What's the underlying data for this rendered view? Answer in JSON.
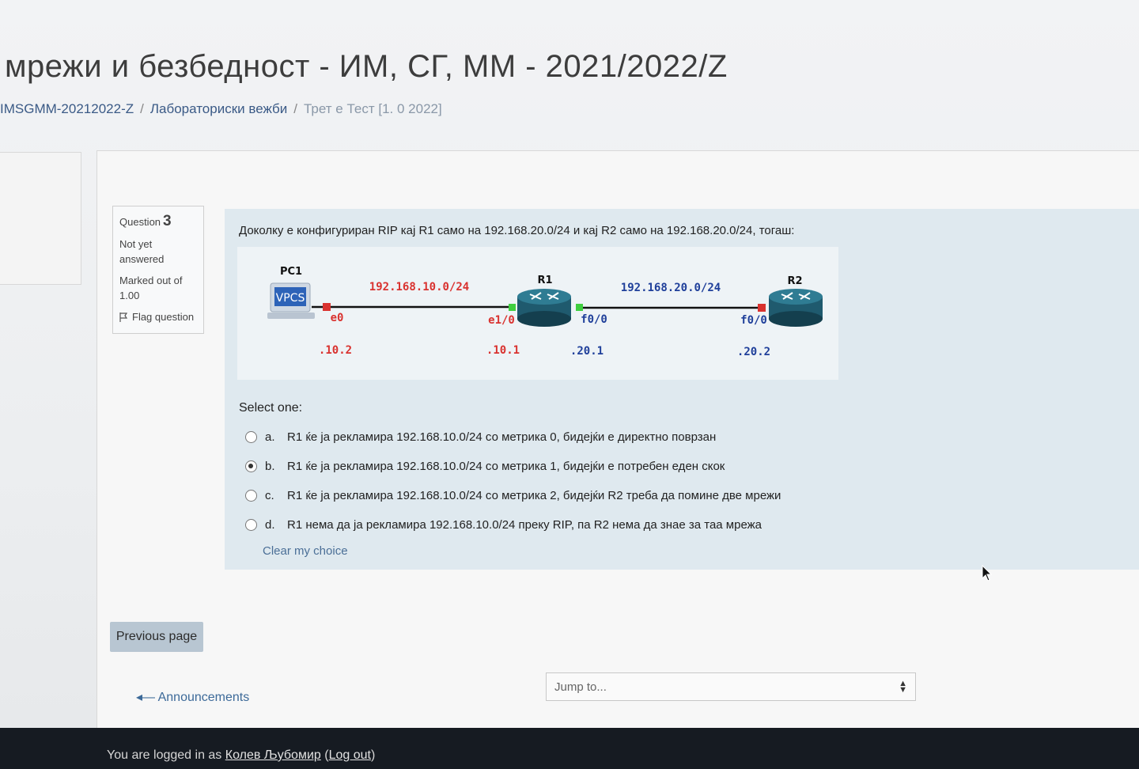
{
  "header": {
    "title": "мрежи и безбедност - ИМ, СГ, ММ - 2021/2022/Z",
    "breadcrumb": [
      "IMSGMM-20212022-Z",
      "Лабораториски вежби",
      "Трет е Тест [1. 0 2022]"
    ]
  },
  "question_info": {
    "label": "Question",
    "number": "3",
    "status": "Not yet answered",
    "marked_label": "Marked out of",
    "marked_value": "1.00",
    "flag_label": "Flag question"
  },
  "question": {
    "text": "Доколку е конфигуриран RIP кај R1 само на 192.168.20.0/24 и кај R2 само на 192.168.20.0/24, тогаш:",
    "diagram": {
      "pc_label": "PC1",
      "pc_badge": "VPCS",
      "r1_label": "R1",
      "r2_label": "R2",
      "net1": "192.168.10.0/24",
      "net2": "192.168.20.0/24",
      "if_pc": "e0",
      "if_r1_left": "e1/0",
      "if_r1_right": "f0/0",
      "if_r2": "f0/0",
      "ip_pc": ".10.2",
      "ip_r1_left": ".10.1",
      "ip_r1_right": ".20.1",
      "ip_r2": ".20.2",
      "colors": {
        "red": "#d9322f",
        "blue": "#1f3f9a",
        "router": "#1f5a6e"
      }
    },
    "select_one": "Select one:",
    "options": [
      {
        "letter": "a.",
        "text": "R1 ќе ја рекламира 192.168.10.0/24 со метрика 0, бидејќи е директно поврзан",
        "checked": false
      },
      {
        "letter": "b.",
        "text": "R1 ќе ја рекламира 192.168.10.0/24 со метрика 1, бидејќи е потребен еден скок",
        "checked": true
      },
      {
        "letter": "c.",
        "text": "R1 ќе ја рекламира 192.168.10.0/24 со метрика 2, бидејќи R2 треба да помине две мрежи",
        "checked": false
      },
      {
        "letter": "d.",
        "text": "R1 нема да ја рекламира 192.168.10.0/24 преку RIP, па R2 нема да знае за таа мрежа",
        "checked": false
      }
    ],
    "clear_choice": "Clear my choice"
  },
  "nav": {
    "previous_page": "Previous page",
    "announcements": "Announcements",
    "jump_placeholder": "Jump to..."
  },
  "footer": {
    "prefix": "You are logged in as ",
    "user": "Колев Љубомир",
    "logout": "Log out"
  }
}
